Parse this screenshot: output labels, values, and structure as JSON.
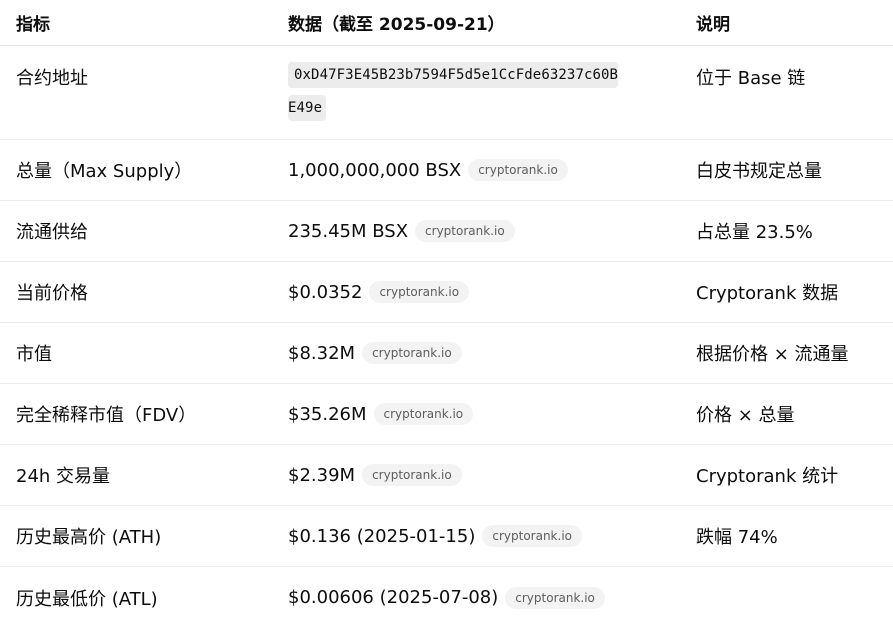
{
  "header": {
    "col1": "指标",
    "col2": "数据（截至 2025-09-21）",
    "col3": "说明"
  },
  "address_row": {
    "label": "合约地址",
    "address_line1": "0xD47F3E45B23b7594F5d5e1CcFde63237c60B",
    "address_line2": "E49e",
    "note": "位于 Base 链"
  },
  "rows": [
    {
      "label": "总量（Max Supply）",
      "value": "1,000,000,000 BSX",
      "source": "cryptorank.io",
      "note": "白皮书规定总量"
    },
    {
      "label": "流通供给",
      "value": "235.45M BSX",
      "source": "cryptorank.io",
      "note": "占总量 23.5%"
    },
    {
      "label": "当前价格",
      "value": "$0.0352",
      "source": "cryptorank.io",
      "note": "Cryptorank 数据"
    },
    {
      "label": "市值",
      "value": "$8.32M",
      "source": "cryptorank.io",
      "note": "根据价格 × 流通量"
    },
    {
      "label": "完全稀释市值（FDV）",
      "value": "$35.26M",
      "source": "cryptorank.io",
      "note": "价格 × 总量"
    },
    {
      "label": "24h 交易量",
      "value": "$2.39M",
      "source": "cryptorank.io",
      "note": "Cryptorank 统计"
    },
    {
      "label": "历史最高价 (ATH)",
      "value": "$0.136 (2025-01-15)",
      "source": "cryptorank.io",
      "note": "跌幅 74%"
    },
    {
      "label": "历史最低价 (ATL)",
      "value": "$0.00606 (2025-07-08)",
      "source": "cryptorank.io",
      "note": ""
    }
  ]
}
